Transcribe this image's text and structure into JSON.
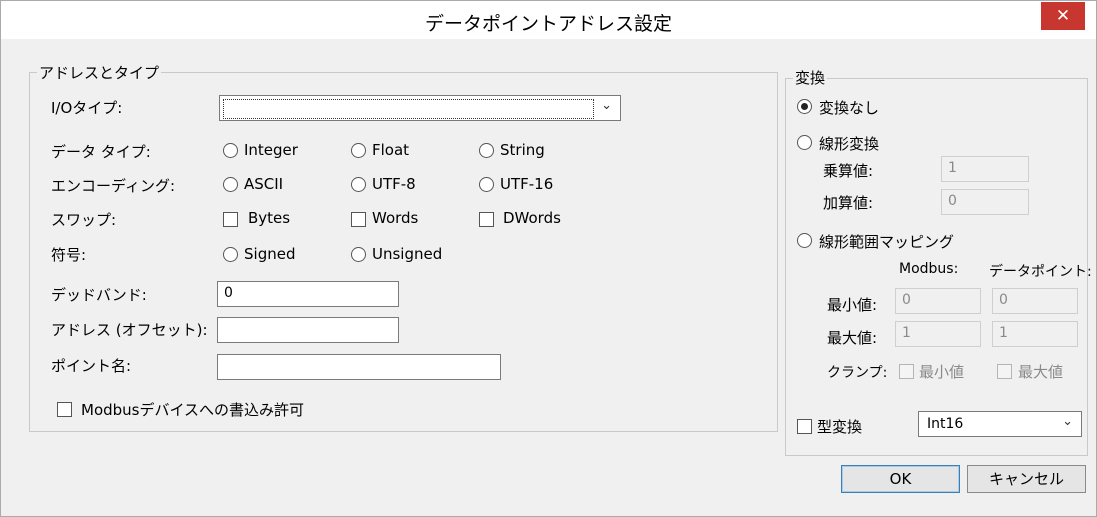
{
  "window": {
    "title": "データポイントアドレス設定",
    "close_label": "✕"
  },
  "address_type": {
    "legend": "アドレスとタイプ",
    "io_type_label": "I/Oタイプ:",
    "io_type_value": "",
    "data_type_label": "データ タイプ:",
    "data_type_options": [
      "Integer",
      "Float",
      "String"
    ],
    "encoding_label": "エンコーディング:",
    "encoding_options": [
      "ASCII",
      "UTF-8",
      "UTF-16"
    ],
    "swap_label": "スワップ:",
    "swap_options": [
      "Bytes",
      "Words",
      "DWords"
    ],
    "sign_label": "符号:",
    "sign_options": [
      "Signed",
      "Unsigned"
    ],
    "deadband_label": "デッドバンド:",
    "deadband_value": "0",
    "address_label": "アドレス (オフセット):",
    "address_value": "",
    "point_name_label": "ポイント名:",
    "point_name_value": "",
    "write_permit_label": "Modbusデバイスへの書込み許可"
  },
  "conversion": {
    "legend": "変換",
    "none_label": "変換なし",
    "linear_label": "線形変換",
    "multiplier_label": "乗算値:",
    "multiplier_value": "1",
    "adder_label": "加算値:",
    "adder_value": "0",
    "range_label": "線形範囲マッピング",
    "col_modbus": "Modbus:",
    "col_datapoint": "データポイント:",
    "min_label": "最小値:",
    "max_label": "最大値:",
    "modbus_min": "0",
    "modbus_max": "1",
    "dp_min": "0",
    "dp_max": "1",
    "clamp_label": "クランプ:",
    "clamp_min_label": "最小値",
    "clamp_max_label": "最大値",
    "type_conv_label": "型変換",
    "type_conv_value": "Int16"
  },
  "buttons": {
    "ok": "OK",
    "cancel": "キャンセル"
  },
  "icons": {
    "dropdown": "chevron-down-icon",
    "close": "close-icon"
  }
}
